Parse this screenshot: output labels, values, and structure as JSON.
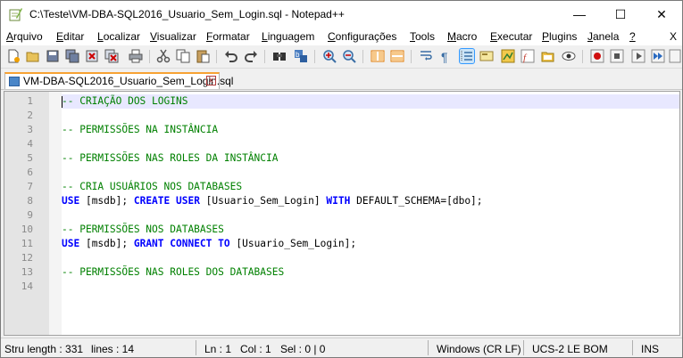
{
  "window": {
    "title": "C:\\Teste\\VM-DBA-SQL2016_Usuario_Sem_Login.sql - Notepad++",
    "minimize_glyph": "—",
    "maximize_glyph": "☐",
    "close_glyph": "✕"
  },
  "menu": {
    "items": [
      {
        "u": "A",
        "rest": "rquivo"
      },
      {
        "u": "E",
        "rest": "ditar"
      },
      {
        "u": "L",
        "rest": "ocalizar"
      },
      {
        "u": "V",
        "rest": "isualizar"
      },
      {
        "u": "F",
        "rest": "ormatar"
      },
      {
        "u": "L",
        "rest": "inguagem"
      },
      {
        "u": "C",
        "rest": "onfigurações"
      },
      {
        "u": "T",
        "rest": "ools"
      },
      {
        "u": "M",
        "rest": "acro"
      },
      {
        "u": "E",
        "rest": "xecutar"
      },
      {
        "u": "P",
        "rest": "lugins"
      },
      {
        "u": "J",
        "rest": "anela"
      },
      {
        "u": "?",
        "rest": ""
      }
    ],
    "close_doc": "X"
  },
  "toolbar": {
    "icons": [
      "new-file-icon",
      "open-file-icon",
      "save-icon",
      "save-all-icon",
      "close-icon",
      "close-all-icon",
      "print-icon",
      "cut-icon",
      "copy-icon",
      "paste-icon",
      "undo-icon",
      "redo-icon",
      "find-icon",
      "replace-icon",
      "zoom-in-icon",
      "zoom-out-icon",
      "sync-vertical-icon",
      "sync-horizontal-icon",
      "word-wrap-icon",
      "show-all-chars-icon",
      "indent-guide-icon",
      "user-language-icon",
      "doc-map-icon",
      "function-list-icon",
      "folder-as-workspace-icon",
      "monitoring-icon",
      "record-macro-icon",
      "stop-record-icon",
      "play-macro-icon",
      "run-macro-multiple-icon",
      "save-macro-icon"
    ]
  },
  "tab": {
    "label": "VM-DBA-SQL2016_Usuario_Sem_Login.sql",
    "close_glyph": "x"
  },
  "editor": {
    "lines": [
      {
        "n": "1",
        "tokens": [
          {
            "t": "-- CRIAÇÃO DOS LOGINS",
            "c": "cm"
          }
        ]
      },
      {
        "n": "2",
        "tokens": []
      },
      {
        "n": "3",
        "tokens": [
          {
            "t": "-- PERMISSÕES NA INSTÂNCIA",
            "c": "cm"
          }
        ]
      },
      {
        "n": "4",
        "tokens": []
      },
      {
        "n": "5",
        "tokens": [
          {
            "t": "-- PERMISSÕES NAS ROLES DA INSTÂNCIA",
            "c": "cm"
          }
        ]
      },
      {
        "n": "6",
        "tokens": []
      },
      {
        "n": "7",
        "tokens": [
          {
            "t": "-- CRIA USUÁRIOS NOS DATABASES",
            "c": "cm"
          }
        ]
      },
      {
        "n": "8",
        "tokens": [
          {
            "t": "USE",
            "c": "kw"
          },
          {
            "t": " [msdb]; ",
            "c": "tx"
          },
          {
            "t": "CREATE USER",
            "c": "kw"
          },
          {
            "t": " [Usuario_Sem_Login] ",
            "c": "tx"
          },
          {
            "t": "WITH",
            "c": "kw"
          },
          {
            "t": " DEFAULT_SCHEMA=[dbo];",
            "c": "tx"
          }
        ]
      },
      {
        "n": "9",
        "tokens": []
      },
      {
        "n": "10",
        "tokens": [
          {
            "t": "-- PERMISSÕES NOS DATABASES",
            "c": "cm"
          }
        ]
      },
      {
        "n": "11",
        "tokens": [
          {
            "t": "USE",
            "c": "kw"
          },
          {
            "t": " [msdb]; ",
            "c": "tx"
          },
          {
            "t": "GRANT CONNECT TO",
            "c": "kw"
          },
          {
            "t": " [Usuario_Sem_Login];",
            "c": "tx"
          }
        ]
      },
      {
        "n": "12",
        "tokens": []
      },
      {
        "n": "13",
        "tokens": [
          {
            "t": "-- PERMISSÕES NAS ROLES DOS DATABASES",
            "c": "cm"
          }
        ]
      },
      {
        "n": "14",
        "tokens": []
      }
    ]
  },
  "status": {
    "length": "Stru length : 331",
    "lines": "lines : 14",
    "ln": "Ln : 1",
    "col": "Col : 1",
    "sel": "Sel : 0 | 0",
    "eol": "Windows (CR LF)",
    "encoding": "UCS-2 LE BOM",
    "mode": "INS"
  },
  "colors": {
    "comment": "#008000",
    "keyword": "#0000ff",
    "current_line": "#e8e8ff",
    "tab_accent": "#f7a233"
  }
}
